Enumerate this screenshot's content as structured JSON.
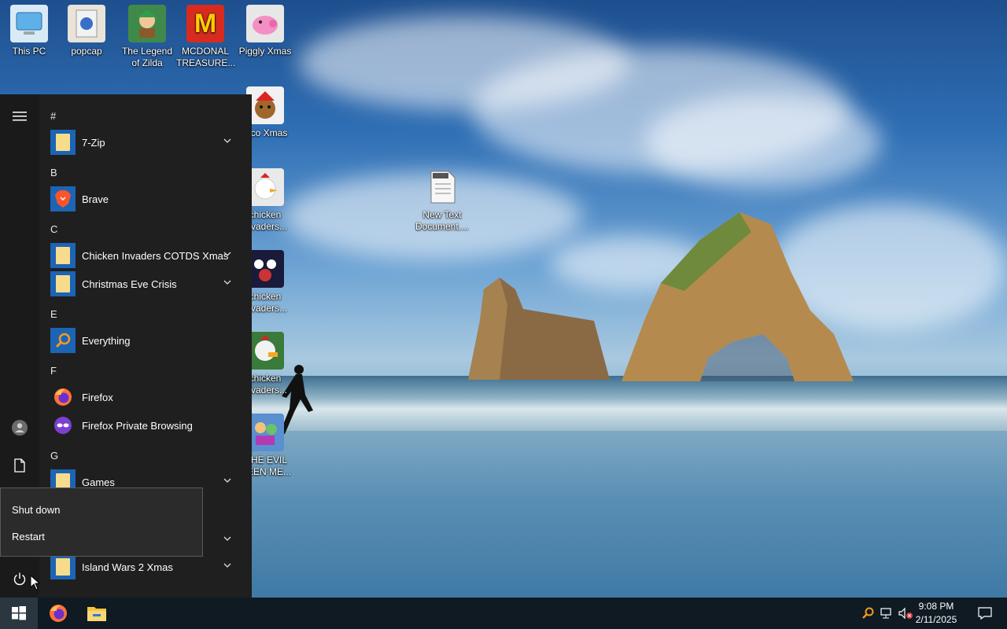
{
  "desktop": {
    "icons": [
      {
        "label_line1": "This PC",
        "label_line2": "",
        "icon": "computer-icon"
      },
      {
        "label_line1": "popcap",
        "label_line2": "",
        "icon": "folder-icon"
      },
      {
        "label_line1": "The Legend",
        "label_line2": "of Zilda",
        "icon": "game-icon"
      },
      {
        "label_line1": "MCDONAL",
        "label_line2": "TREASURE...",
        "icon": "mcdonalds-icon"
      },
      {
        "label_line1": "Piggly Xmas",
        "label_line2": "",
        "icon": "pig-icon"
      },
      {
        "label_line1": "...co Xmas",
        "label_line2": "",
        "icon": "bear-icon"
      },
      {
        "label_line1": "New Text",
        "label_line2": "Document....",
        "icon": "text-document-icon"
      },
      {
        "label_line1": "chicken",
        "label_line2": "...vaders...",
        "icon": "chicken-icon"
      },
      {
        "label_line1": "chicken",
        "label_line2": "...vaders...",
        "icon": "chicken-icon"
      },
      {
        "label_line1": "chicken",
        "label_line2": "...vaders...",
        "icon": "chicken-icon"
      },
      {
        "label_line1": "...HE EVIL",
        "label_line2": "...EEN ME...",
        "icon": "evil-game-icon"
      }
    ]
  },
  "start_menu": {
    "rail": {
      "menu_icon": "hamburger-icon",
      "user_icon": "user-icon",
      "documents_icon": "document-icon",
      "power_icon": "power-icon"
    },
    "sections": [
      {
        "letter": "#",
        "apps": [
          {
            "label": "7-Zip",
            "icon": "folder-icon",
            "expandable": true
          }
        ]
      },
      {
        "letter": "B",
        "apps": [
          {
            "label": "Brave",
            "icon": "brave-icon",
            "expandable": false
          }
        ]
      },
      {
        "letter": "C",
        "apps": [
          {
            "label": "Chicken Invaders COTDS Xmas",
            "icon": "folder-icon",
            "expandable": true
          },
          {
            "label": "Christmas Eve Crisis",
            "icon": "folder-icon",
            "expandable": true
          }
        ]
      },
      {
        "letter": "E",
        "apps": [
          {
            "label": "Everything",
            "icon": "search-icon",
            "expandable": false
          }
        ]
      },
      {
        "letter": "F",
        "apps": [
          {
            "label": "Firefox",
            "icon": "firefox-icon",
            "expandable": false
          },
          {
            "label": "Firefox Private Browsing",
            "icon": "firefox-private-icon",
            "expandable": false
          }
        ]
      },
      {
        "letter": "G",
        "apps": [
          {
            "label": "Games",
            "icon": "folder-icon",
            "expandable": true
          }
        ]
      },
      {
        "letter": "",
        "apps": [
          {
            "label": "Island Wars 2 Xmas",
            "icon": "folder-icon",
            "expandable": true
          }
        ]
      }
    ]
  },
  "power_flyout": {
    "items": [
      "Shut down",
      "Restart"
    ]
  },
  "taskbar": {
    "start_icon": "windows-icon",
    "pinned": [
      "firefox-icon",
      "file-explorer-icon"
    ],
    "tray_icons": [
      "everything-search-icon",
      "network-icon",
      "volume-muted-icon"
    ],
    "time": "9:08 PM",
    "date": "2/11/2025",
    "notification_icon": "action-center-icon"
  },
  "colors": {
    "start_menu_bg": "#1f1f1f",
    "taskbar_bg": "#0f1a22",
    "folder_tile": "#1c64b4",
    "folder_glyph": "#f6dc8c"
  }
}
